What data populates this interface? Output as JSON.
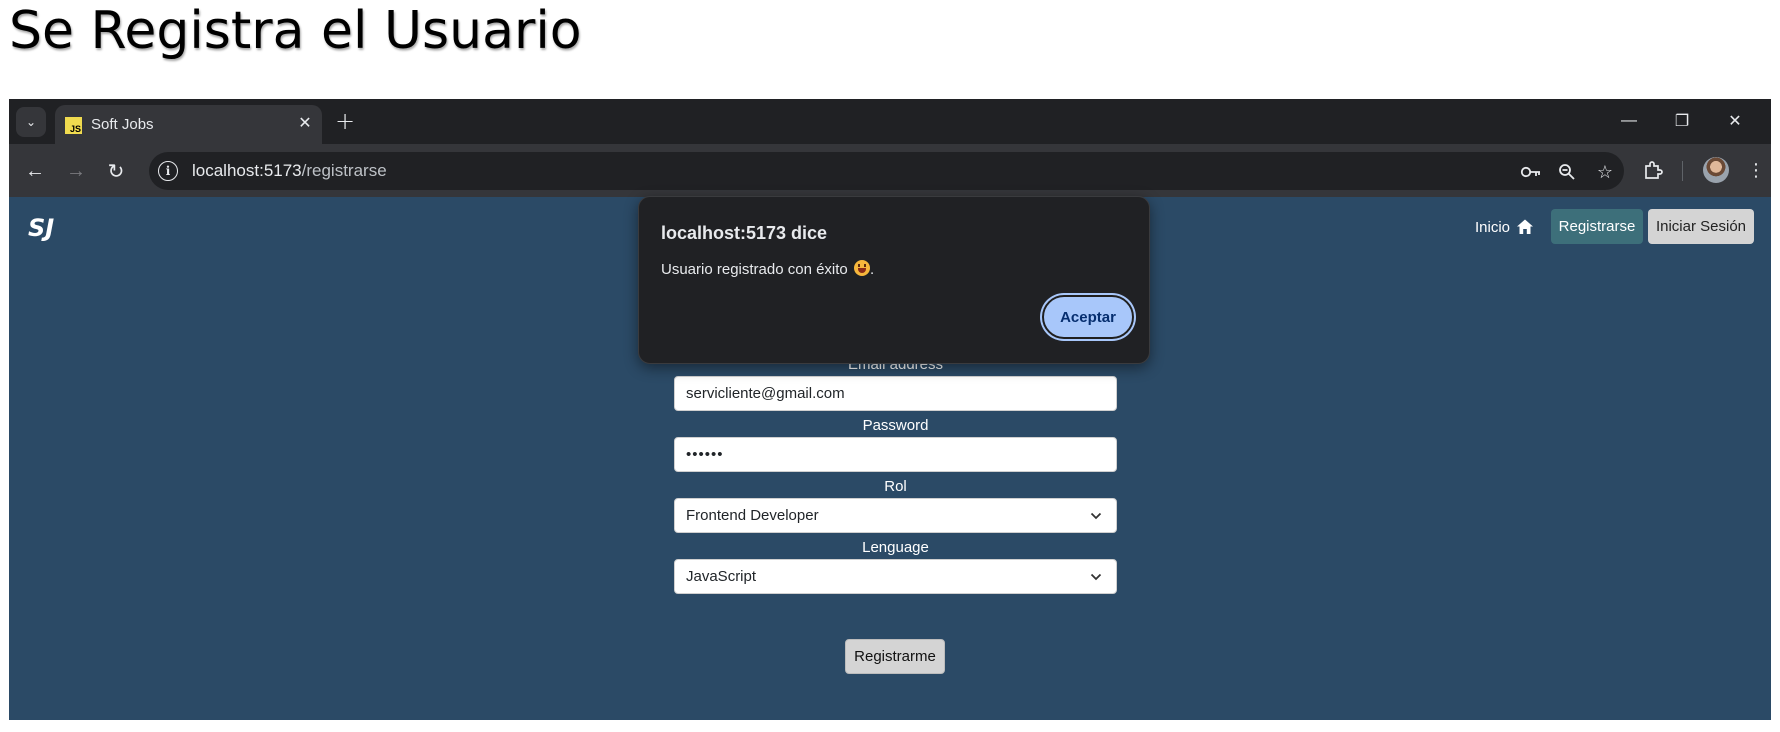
{
  "slide": {
    "title": "Se Registra el Usuario"
  },
  "browser": {
    "tab": {
      "title": "Soft Jobs",
      "favicon_text": "JS",
      "favicon_color": "#f0db4f"
    },
    "address_bar": {
      "host": "localhost:5173",
      "path": "/registrarse"
    },
    "icons": {
      "tab_search": "chevron-down-icon",
      "tab_close": "close-icon",
      "new_tab": "plus-icon",
      "minimize": "minimize-icon",
      "restore": "restore-icon",
      "close_window": "close-icon",
      "back": "back-arrow-icon",
      "forward": "forward-arrow-icon",
      "reload": "reload-icon",
      "site_info": "info-icon",
      "password_key": "key-icon",
      "zoom": "zoom-out-icon",
      "bookmark": "star-icon",
      "extensions": "puzzle-icon",
      "menu": "kebab-menu-icon"
    },
    "glyphs": {
      "tab_search": "⌄",
      "tab_close": "✕",
      "new_tab": "+",
      "minimize": "—",
      "restore": "❐",
      "close_window": "✕",
      "back": "←",
      "forward": "→",
      "reload": "↻",
      "site_info": "i",
      "zoom": "⚲",
      "bookmark": "☆",
      "menu": "⋮"
    }
  },
  "app": {
    "brand": "SJ",
    "nav": {
      "home": "Inicio",
      "register": "Registrarse",
      "login": "Iniciar Sesión"
    },
    "form": {
      "email": {
        "label": "Email address",
        "value": "servicliente@gmail.com"
      },
      "password": {
        "label": "Password",
        "value": "••••••"
      },
      "role": {
        "label": "Rol",
        "value": "Frontend Developer"
      },
      "language": {
        "label": "Lenguage",
        "value": "JavaScript"
      },
      "submit": "Registrarme"
    },
    "colors": {
      "background": "#2b4a66",
      "primary_button": "#3d6f7a"
    }
  },
  "dialog": {
    "title": "localhost:5173 dice",
    "message": "Usuario registrado con éxito",
    "message_end": ".",
    "ok": "Aceptar"
  }
}
